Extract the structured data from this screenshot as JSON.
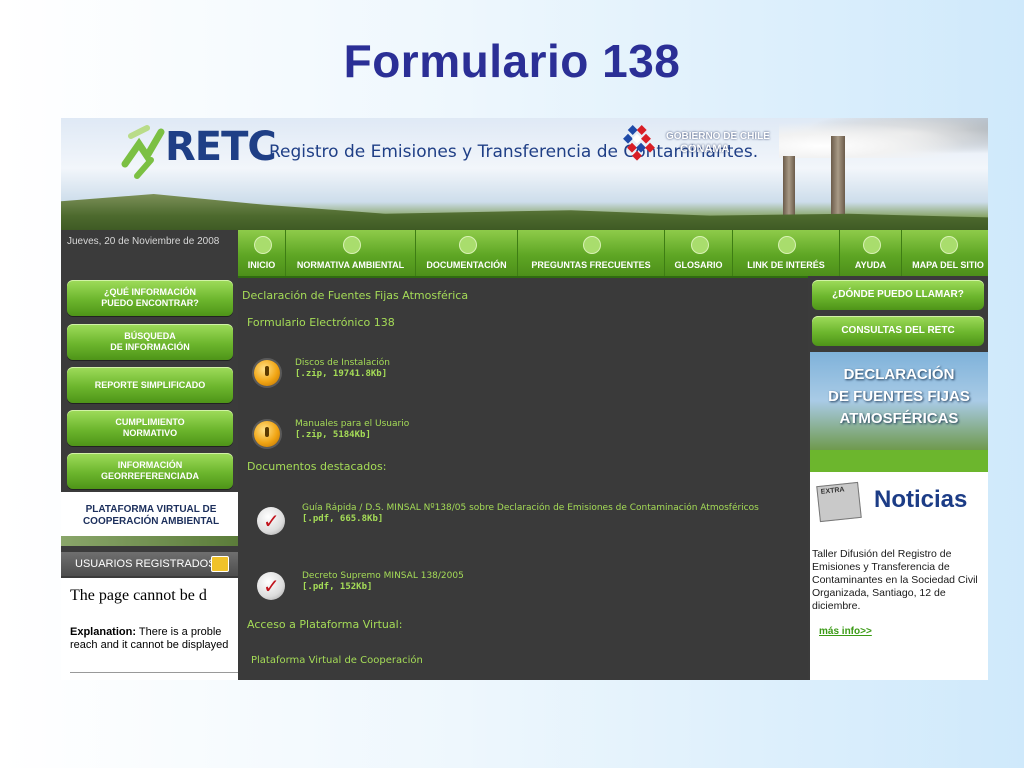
{
  "slide": {
    "title": "Formulario 138"
  },
  "header": {
    "logo_text": "RETC",
    "tagline": "Registro de Emisiones y Transferencia de Contaminantes.",
    "gov_line1": "GOBIERNO DE CHILE",
    "gov_line2": "CONAMA"
  },
  "datebar": {
    "date": "Jueves, 20 de Noviembre de 2008"
  },
  "nav": {
    "items": [
      {
        "label": "INICIO",
        "icon": "home-icon"
      },
      {
        "label": "NORMATIVA AMBIENTAL",
        "icon": "drop-icon"
      },
      {
        "label": "DOCUMENTACIÓN",
        "icon": "folder-icon"
      },
      {
        "label": "PREGUNTAS FRECUENTES",
        "icon": "question-icon"
      },
      {
        "label": "GLOSARIO",
        "icon": "book-icon"
      },
      {
        "label": "LINK DE INTERÉS",
        "icon": "link-icon"
      },
      {
        "label": "AYUDA",
        "icon": "info-icon"
      },
      {
        "label": "MAPA DEL SITIO",
        "icon": "sitemap-icon"
      }
    ]
  },
  "left": {
    "buttons": [
      {
        "line1": "¿QUÉ INFORMACIÓN",
        "line2": "PUEDO ENCONTRAR?"
      },
      {
        "line1": "BÚSQUEDA",
        "line2": "DE INFORMACIÓN"
      },
      {
        "line1": "REPORTE SIMPLIFICADO",
        "line2": ""
      },
      {
        "line1": "CUMPLIMIENTO",
        "line2": "NORMATIVO"
      },
      {
        "line1": "INFORMACIÓN",
        "line2": "GEORREFERENCIADA"
      }
    ],
    "plataforma_line1": "PLATAFORMA VIRTUAL DE",
    "plataforma_line2": "COOPERACIÓN AMBIENTAL",
    "users_title": "USUARIOS REGISTRADOS",
    "error_title": "The page cannot be d",
    "error_label": "Explanation:",
    "error_line1": " There is a proble",
    "error_line2": "reach and it cannot be displayed"
  },
  "main": {
    "heading": "Declaración de Fuentes Fijas Atmosférica",
    "subheading": "Formulario Electrónico 138",
    "files": [
      {
        "title": "Discos de Instalación",
        "meta": "[.zip, 19741.8Kb]"
      },
      {
        "title": "Manuales para el Usuario",
        "meta": "[.zip, 5184Kb]"
      }
    ],
    "docs_heading": "Documentos destacados:",
    "docs": [
      {
        "title": "Guía Rápida / D.S. MINSAL Nº138/05 sobre Declaración de Emisiones de Contaminación Atmosféricos",
        "meta": "[.pdf, 665.8Kb]"
      },
      {
        "title": "Decreto Supremo MINSAL 138/2005",
        "meta": "[.pdf, 152Kb]"
      }
    ],
    "plataforma_heading": "Acceso a Plataforma Virtual:",
    "plataforma_link": "Plataforma Virtual de Cooperación"
  },
  "right": {
    "btn_llamar": "¿DÓNDE PUEDO LLAMAR?",
    "btn_consultas": "CONSULTAS DEL RETC",
    "declar_line1": "DECLARACIÓN",
    "declar_line2": "DE FUENTES FIJAS",
    "declar_line3": "ATMOSFÉRICAS",
    "news_title": "Noticias",
    "news_badge": "EXTRA",
    "news_body": "Taller Difusión del Registro de Emisiones y Transferencia de Contaminantes en la Sociedad Civil Organizada, Santiago, 12 de diciembre.",
    "news_more": "más info>>"
  },
  "colors": {
    "title_blue": "#2b2f96",
    "nav_green": "#5ea624",
    "content_bg": "#3a3a3a",
    "link_green": "#a5dc57"
  }
}
